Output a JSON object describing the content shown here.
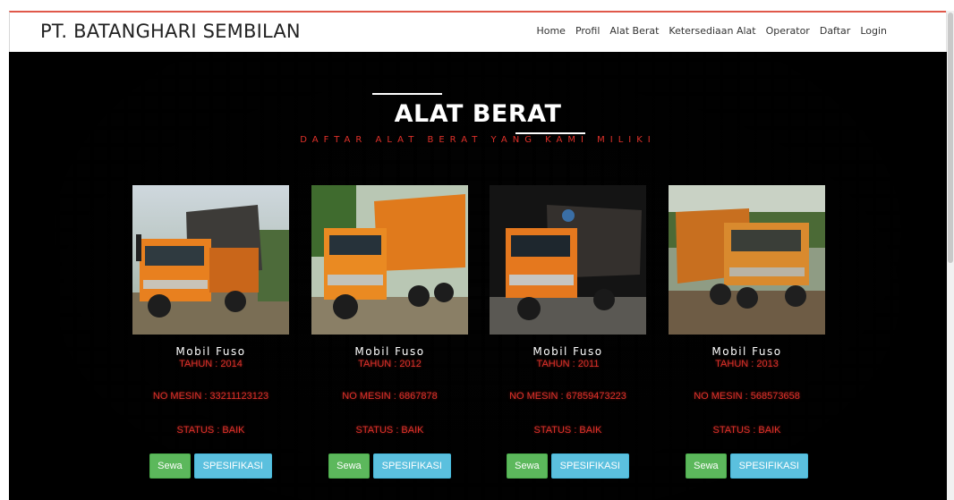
{
  "navbar": {
    "brand": "PT. BATANGHARI SEMBILAN",
    "links": [
      "Home",
      "Profil",
      "Alat Berat",
      "Ketersediaan Alat",
      "Operator",
      "Daftar",
      "Login"
    ]
  },
  "section": {
    "title": "ALAT BERAT",
    "subtitle": "DAFTAR ALAT BERAT YANG KAMI MILIKI"
  },
  "vehicles": [
    {
      "name": "Mobil Fuso",
      "year": "TAHUN : 2014",
      "engine": "NO MESIN : 33211123123",
      "status": "STATUS : BAIK",
      "rent_label": "Sewa",
      "spec_label": "SPESIFIKASI",
      "photo_icon": "orange-dump-truck-photo"
    },
    {
      "name": "Mobil Fuso",
      "year": "TAHUN : 2012",
      "engine": "NO MESIN : 6867878",
      "status": "STATUS : BAIK",
      "rent_label": "Sewa",
      "spec_label": "SPESIFIKASI",
      "photo_icon": "orange-dump-truck-photo"
    },
    {
      "name": "Mobil Fuso",
      "year": "TAHUN : 2011",
      "engine": "NO MESIN : 67859473223",
      "status": "STATUS : BAIK",
      "rent_label": "Sewa",
      "spec_label": "SPESIFIKASI",
      "photo_icon": "orange-dump-truck-photo"
    },
    {
      "name": "Mobil Fuso",
      "year": "TAHUN : 2013",
      "engine": "NO MESIN : 568573658",
      "status": "STATUS : BAIK",
      "rent_label": "Sewa",
      "spec_label": "SPESIFIKASI",
      "photo_icon": "orange-dump-truck-photo"
    }
  ],
  "colors": {
    "accent_red": "#e0312a",
    "sewa_green": "#5cb85c",
    "spec_blue": "#5bc0de",
    "truck_orange": "#e8801f"
  }
}
